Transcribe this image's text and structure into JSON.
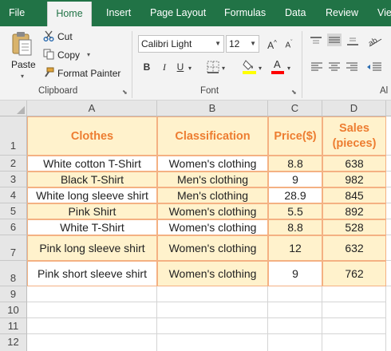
{
  "tabs": [
    "File",
    "Home",
    "Insert",
    "Page Layout",
    "Formulas",
    "Data",
    "Review",
    "View"
  ],
  "active_tab": "Home",
  "clipboard": {
    "paste_label": "Paste",
    "cut_label": "Cut",
    "copy_label": "Copy",
    "format_painter_label": "Format Painter",
    "group_label": "Clipboard"
  },
  "font": {
    "font_name": "Calibri Light",
    "font_size": "12",
    "group_label": "Font",
    "bold": "B",
    "italic": "I",
    "underline": "U",
    "grow": "A",
    "shrink": "A",
    "font_color_letter": "A",
    "fill_color": "#ffff00",
    "font_color": "#ff0000"
  },
  "alignment": {
    "group_label": "Al"
  },
  "columns": [
    "A",
    "B",
    "C",
    "D"
  ],
  "rows": [
    {
      "num": "1",
      "cells": [
        "Clothes",
        "Classification",
        "Price($)",
        "Sales\n(pieces)"
      ]
    },
    {
      "num": "2",
      "cells": [
        "White cotton T-Shirt",
        "Women's clothing",
        "8.8",
        "638"
      ]
    },
    {
      "num": "3",
      "cells": [
        "Black T-Shirt",
        "Men's clothing",
        "9",
        "982"
      ]
    },
    {
      "num": "4",
      "cells": [
        "White long sleeve shirt",
        "Men's clothing",
        "28.9",
        "845"
      ]
    },
    {
      "num": "5",
      "cells": [
        "Pink Shirt",
        "Women's clothing",
        "5.5",
        "892"
      ]
    },
    {
      "num": "6",
      "cells": [
        "White T-Shirt",
        "Women's clothing",
        "8.8",
        "528"
      ]
    },
    {
      "num": "7",
      "cells": [
        "Pink long sleeve shirt",
        "Women's clothing",
        "12",
        "632"
      ]
    },
    {
      "num": "8",
      "cells": [
        "Pink short sleeve shirt",
        "Women's clothing",
        "9",
        "762"
      ]
    },
    {
      "num": "9",
      "cells": [
        "",
        "",
        "",
        ""
      ]
    },
    {
      "num": "10",
      "cells": [
        "",
        "",
        "",
        ""
      ]
    },
    {
      "num": "11",
      "cells": [
        "",
        "",
        "",
        ""
      ]
    },
    {
      "num": "12",
      "cells": [
        "",
        "",
        "",
        ""
      ]
    }
  ],
  "colors": {
    "ribbon_green": "#217346",
    "header_text": "#ed7d31",
    "cell_highlight": "#fff2cc"
  }
}
